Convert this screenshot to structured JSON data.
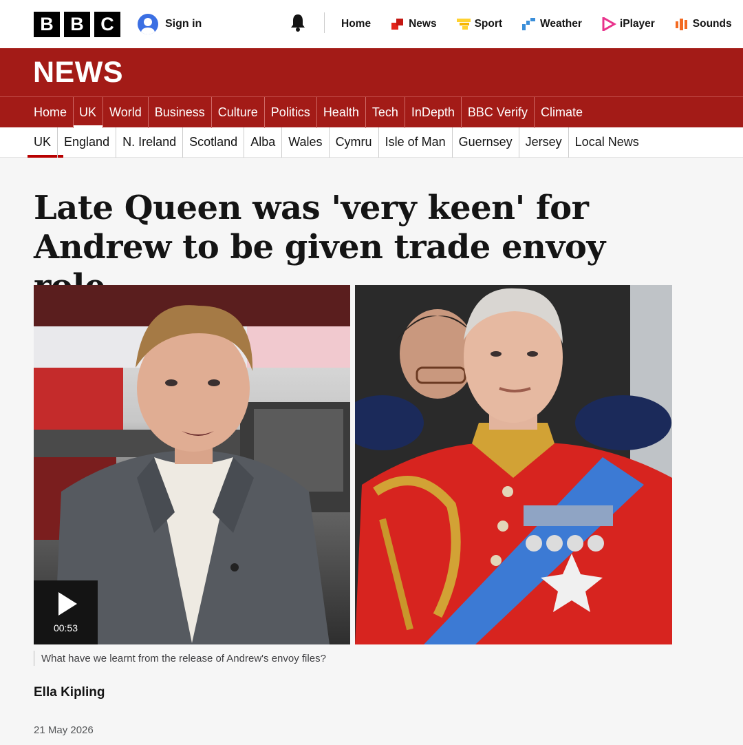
{
  "masthead": {
    "logo_letters": [
      "B",
      "B",
      "C"
    ],
    "signin_label": "Sign in",
    "nav": [
      {
        "label": "Home",
        "icon": "none"
      },
      {
        "label": "News",
        "icon": "news-icon",
        "color": "#e3251b"
      },
      {
        "label": "Sport",
        "icon": "sport-icon",
        "color": "#ffd230"
      },
      {
        "label": "Weather",
        "icon": "weather-icon",
        "color": "#3a8ed9"
      },
      {
        "label": "iPlayer",
        "icon": "iplayer-icon",
        "color": "#e9338c"
      },
      {
        "label": "Sounds",
        "icon": "sounds-icon",
        "color": "#f36a21"
      }
    ]
  },
  "banner": {
    "title": "NEWS",
    "color": "#a31b17"
  },
  "section_nav": [
    "Home",
    "UK",
    "World",
    "Business",
    "Culture",
    "Politics",
    "Health",
    "Tech",
    "InDepth",
    "BBC Verify",
    "Climate"
  ],
  "section_nav_active": "UK",
  "sub_nav": [
    "UK",
    "England",
    "N. Ireland",
    "Scotland",
    "Alba",
    "Wales",
    "Cymru",
    "Isle of Man",
    "Guernsey",
    "Jersey",
    "Local News"
  ],
  "sub_nav_active": "UK",
  "article": {
    "headline": "Late Queen was 'very keen' for Andrew to be given trade envoy role",
    "video_duration": "00:53",
    "caption": "What have we learnt from the release of Andrew's envoy files?",
    "author": "Ella Kipling",
    "date": "21 May 2026"
  }
}
